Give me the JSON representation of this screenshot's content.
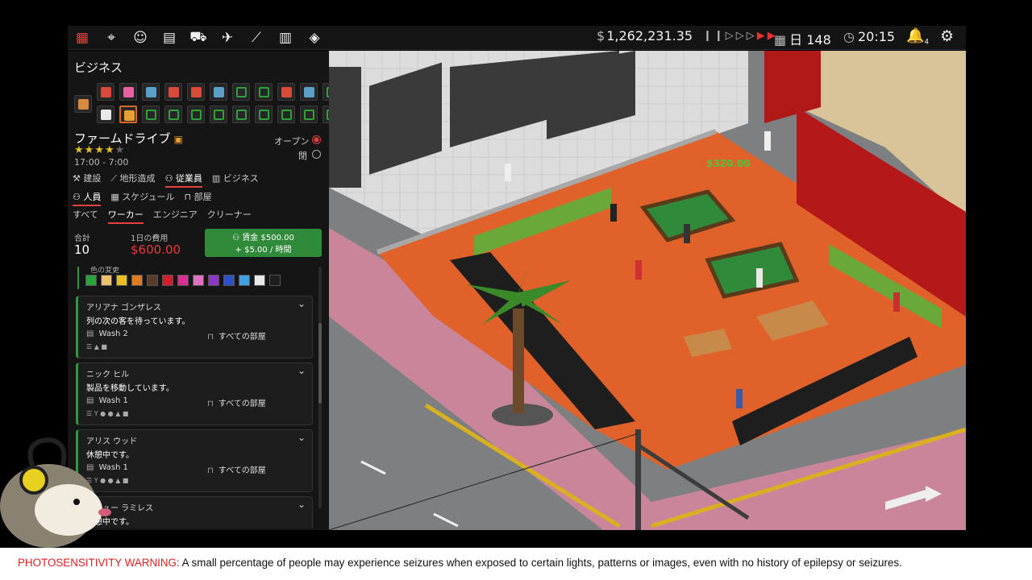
{
  "topbar": {
    "nav_icons": [
      "building-icon",
      "map-icon",
      "staff-icon",
      "briefcase-icon",
      "delivery-truck-icon",
      "airplane-icon",
      "chart-icon",
      "ledger-icon",
      "layers-icon"
    ],
    "currency_symbol": "$",
    "money": "1,262,231.35",
    "day_label": "日 148",
    "time": "20:15",
    "notification_count": "4"
  },
  "panel": {
    "title": "ビジネス",
    "business_icons": [
      {
        "color": "#d98a3a",
        "selected": false,
        "name": "cardboard-box-icon"
      },
      {
        "color": "#d94a3a",
        "selected": false,
        "name": "chef-icon"
      },
      {
        "color": "#e860a0",
        "selected": false,
        "name": "donut-icon"
      },
      {
        "color": "#58a0c8",
        "selected": false,
        "name": "washing-machine-icon"
      },
      {
        "color": "#d94a3a",
        "selected": false,
        "name": "food-icon"
      },
      {
        "color": "#d94a3a",
        "selected": false,
        "name": "chef-icon"
      },
      {
        "color": "#58a0c8",
        "selected": false,
        "name": "washing-machine-icon"
      },
      {
        "color": "#2fa03a",
        "selected": false,
        "name": "frame-icon"
      },
      {
        "color": "#2fa03a",
        "selected": false,
        "name": "frame-icon"
      },
      {
        "color": "#d94a3a",
        "selected": false,
        "name": "chef-icon"
      },
      {
        "color": "#58a0c8",
        "selected": false,
        "name": "washing-machine-icon"
      },
      {
        "color": "#2fa03a",
        "selected": false,
        "name": "frame-icon"
      },
      {
        "color": "#e8e8e8",
        "selected": false,
        "name": "cocktail-icon"
      },
      {
        "color": "#e8a030",
        "selected": true,
        "name": "slot-machine-icon"
      },
      {
        "color": "#2fa03a",
        "selected": false,
        "name": "frame-icon"
      },
      {
        "color": "#2fa03a",
        "selected": false,
        "name": "frame-icon"
      },
      {
        "color": "#2fa03a",
        "selected": false,
        "name": "frame-icon"
      },
      {
        "color": "#2fa03a",
        "selected": false,
        "name": "frame-icon"
      },
      {
        "color": "#2fa03a",
        "selected": false,
        "name": "frame-icon"
      },
      {
        "color": "#2fa03a",
        "selected": false,
        "name": "frame-icon"
      },
      {
        "color": "#2fa03a",
        "selected": false,
        "name": "frame-icon"
      },
      {
        "color": "#2fa03a",
        "selected": false,
        "name": "frame-icon"
      },
      {
        "color": "#2fa03a",
        "selected": false,
        "name": "frame-icon"
      }
    ],
    "business_name": "ファームドライブ",
    "rating": 4,
    "rating_max": 5,
    "hours": "17:00 - 7:00",
    "open_label": "オープン",
    "closed_label": "閉",
    "status_open": true,
    "main_tabs": [
      "建設",
      "地形造成",
      "従業員",
      "ビジネス"
    ],
    "main_tab_active": 2,
    "sub_tabs": [
      "人員",
      "スケジュール",
      "部屋"
    ],
    "sub_tab_active": 0,
    "role_tabs": [
      "すべて",
      "ワーカー",
      "エンジニア",
      "クリーナー"
    ],
    "role_tab_active": 1,
    "total_label": "合計",
    "total_value": "10",
    "daily_cost_label": "1日の費用",
    "daily_cost_value": "$600.00",
    "hire_line1": "賃金 $500.00",
    "hire_line2": "+ $5.00 / 時間",
    "color_change_label": "色の変更",
    "colors": [
      "#2fa03a",
      "#e8c070",
      "#e8c020",
      "#e07a20",
      "#5a3a28",
      "#d02030",
      "#d83090",
      "#e070c0",
      "#8a38c8",
      "#3050c8",
      "#40a0e0",
      "#e8e8e8",
      "#1e1e1e"
    ],
    "employees": [
      {
        "name": "アリアナ ゴンザレス",
        "status": "列の次の客を待っています。",
        "room": "Wash 2",
        "area": "すべての部屋",
        "skills": "☰ ▲ ■"
      },
      {
        "name": "ニック ヒル",
        "status": "製品を移動しています。",
        "room": "Wash 1",
        "area": "すべての部屋",
        "skills": "☰ Y ● ● ▲ ■"
      },
      {
        "name": "アリス ウッド",
        "status": "休憩中です。",
        "room": "Wash 1",
        "area": "すべての部屋",
        "skills": "☰ Y ● ● ▲ ■"
      },
      {
        "name": "マシュー ラミレス",
        "status": "休憩中です。",
        "room": "",
        "area": "",
        "skills": ""
      }
    ]
  },
  "game": {
    "floating_money": "$320.00"
  },
  "warning": {
    "label": "PHOTOSENSITIVITY WARNING:",
    "text": " A small percentage of people may experience seizures when exposed to certain lights, patterns or images, even with no history of epilepsy or seizures."
  }
}
